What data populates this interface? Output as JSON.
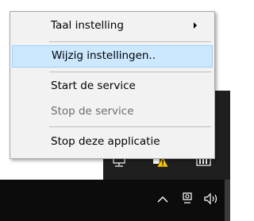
{
  "context_menu": {
    "items": [
      {
        "label": "Taal instelling",
        "enabled": true,
        "has_submenu": true
      },
      {
        "label": "Wijzig instellingen..",
        "enabled": true,
        "highlighted": true
      },
      {
        "label": "Start de service",
        "enabled": true
      },
      {
        "label": "Stop de service",
        "enabled": false
      },
      {
        "label": "Stop deze applicatie",
        "enabled": true
      }
    ]
  },
  "tray": {
    "icons": [
      "network-icon",
      "warning-shield-icon",
      "battery-icon",
      "status-green-icon"
    ]
  },
  "taskbar": {
    "icons": [
      "chevron-up-icon",
      "meet-now-icon",
      "volume-icon"
    ]
  },
  "colors": {
    "menu_background": "#f2f2f2",
    "menu_highlight": "#cce8ff",
    "menu_highlight_border": "#99d1ff",
    "disabled_text": "#6d6d6d",
    "taskbar": "#0c0c0c",
    "tray_popup": "#1f1f1f"
  }
}
